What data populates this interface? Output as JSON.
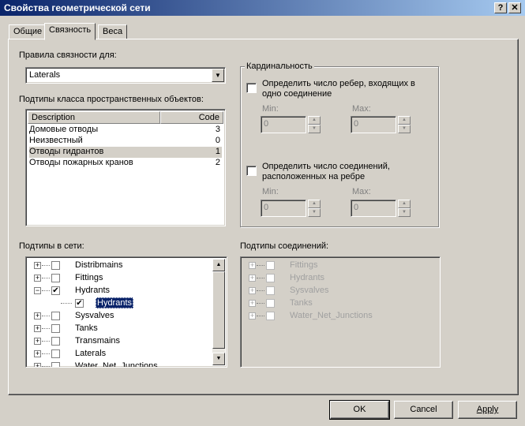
{
  "window": {
    "title": "Свойства геометрической сети",
    "help_btn": "?",
    "close_btn": "✕"
  },
  "tabs": [
    {
      "label": "Общие"
    },
    {
      "label": "Связность"
    },
    {
      "label": "Веса"
    }
  ],
  "rules": {
    "label": "Правила связности для:",
    "selected": "Laterals",
    "arrow": "▼"
  },
  "subtypes": {
    "label": "Подтипы класса пространственных объектов:",
    "columns": [
      "Description",
      "Code"
    ],
    "rows": [
      {
        "description": "Домовые отводы",
        "code": "3"
      },
      {
        "description": "Неизвестный",
        "code": "0"
      },
      {
        "description": "Отводы гидрантов",
        "code": "1"
      },
      {
        "description": "Отводы пожарных кранов",
        "code": "2"
      }
    ]
  },
  "cardinality": {
    "label": "Кардинальность",
    "edges_check": "Определить число ребер, входящих в одно соединение",
    "junctions_check": "Определить число соединений, расположенных на ребре",
    "min_label": "Min:",
    "max_label": "Max:",
    "edges_min": "0",
    "edges_max": "0",
    "junctions_min": "0",
    "junctions_max": "0",
    "spin_up": "▲",
    "spin_down": "▼"
  },
  "network_subtypes": {
    "label": "Подтипы в сети:",
    "items": [
      {
        "label": "Distribmains",
        "expander": "+",
        "checked": ""
      },
      {
        "label": "Fittings",
        "expander": "+",
        "checked": ""
      },
      {
        "label": "Hydrants",
        "expander": "−",
        "checked": "✔"
      },
      {
        "label": "Hydrants",
        "expander": "",
        "checked": "✔"
      },
      {
        "label": "Sysvalves",
        "expander": "+",
        "checked": ""
      },
      {
        "label": "Tanks",
        "expander": "+",
        "checked": ""
      },
      {
        "label": "Transmains",
        "expander": "+",
        "checked": ""
      },
      {
        "label": "Laterals",
        "expander": "+",
        "checked": ""
      },
      {
        "label": "Water_Net_Junctions",
        "expander": "+",
        "checked": ""
      }
    ],
    "scroll_up": "▲",
    "scroll_down": "▼"
  },
  "junction_subtypes": {
    "label": "Подтипы соединений:",
    "items": [
      {
        "label": "Fittings",
        "expander": "+"
      },
      {
        "label": "Hydrants",
        "expander": "+"
      },
      {
        "label": "Sysvalves",
        "expander": "+"
      },
      {
        "label": "Tanks",
        "expander": "+"
      },
      {
        "label": "Water_Net_Junctions",
        "expander": "+"
      }
    ]
  },
  "buttons": {
    "ok": "OK",
    "cancel": "Cancel",
    "apply": "Apply"
  }
}
